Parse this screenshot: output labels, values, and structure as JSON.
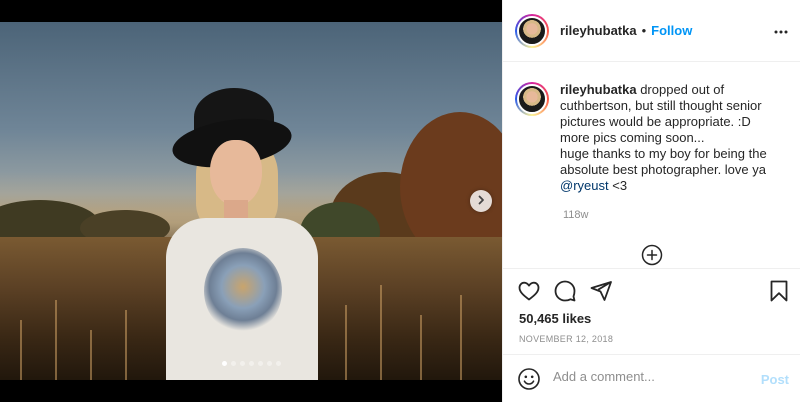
{
  "post": {
    "username": "rileyhubatka",
    "separator": "•",
    "follow_label": "Follow",
    "caption": {
      "username": "rileyhubatka",
      "text": " dropped out of cuthbertson, but still thought senior pictures would be appropriate. :D more pics coming soon...",
      "text2": "huge thanks to my boy for being the absolute best photographer. love ya ",
      "mention": "@ryeust",
      "tail": " <3"
    },
    "time_ago": "118w",
    "likes": "50,465 likes",
    "date": "November 12, 2018",
    "carousel": {
      "dot_count": 7,
      "active_index": 0
    }
  },
  "comment": {
    "placeholder": "Add a comment...",
    "post_label": "Post"
  },
  "icons": {
    "more": "more-options-icon",
    "next": "chevron-right-icon",
    "load_more": "plus-circle-icon",
    "like": "heart-icon",
    "comment": "comment-bubble-icon",
    "share": "paper-plane-icon",
    "save": "bookmark-icon",
    "emoji": "smiley-icon"
  },
  "colors": {
    "accent": "#0095f6",
    "text": "#262626",
    "muted": "#8e8e8e",
    "post_disabled": "#b2dffc"
  }
}
